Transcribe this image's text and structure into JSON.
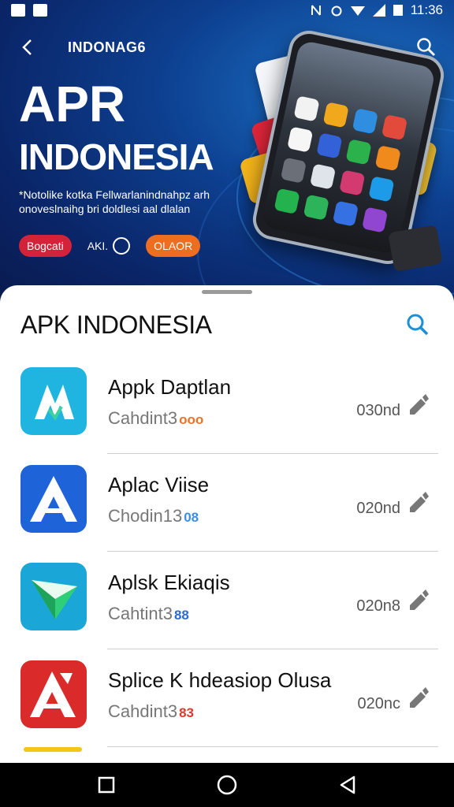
{
  "status_bar": {
    "time": "11:36"
  },
  "topbar": {
    "title": "INDONAG6"
  },
  "hero": {
    "title_line1": "APR",
    "title_line2": "INDONESIA",
    "subtitle": "*Notolike kotka Fellwarlanindnahpz arh onoveslnaihg bri doldlesi aal dlalan",
    "btn_red": "Bogcati",
    "btn_outline": "AKI.",
    "btn_orange": "OLAOR"
  },
  "sheet": {
    "title": "APK INDONESIA"
  },
  "apps": [
    {
      "name": "Appk Daptlan",
      "category": "Cahdint3",
      "badge": "ooo",
      "badge_color": "#e8742a",
      "size": "030nd",
      "icon_bg": "#1fb5e0"
    },
    {
      "name": "Aplac Viise",
      "category": "Chodin13",
      "badge": "08",
      "badge_color": "#3a8ee8",
      "size": "020nd",
      "icon_bg": "#1f63d9"
    },
    {
      "name": "Aplsk Ekiaqis",
      "category": "Cahtint3",
      "badge": "88",
      "badge_color": "#2a6ad6",
      "size": "020n8",
      "icon_bg": "#1ba6d8"
    },
    {
      "name": "Splice K hdeasiop Olusa",
      "category": "Cahdint3",
      "badge": "83",
      "badge_color": "#d93a30",
      "size": "020nc",
      "icon_bg": "#db2a2a"
    }
  ],
  "icons": {
    "back": "arrow-left-icon",
    "search": "search-icon",
    "edit": "pencil-icon",
    "nav_recent": "square-icon",
    "nav_home": "circle-icon",
    "nav_back": "triangle-icon"
  }
}
